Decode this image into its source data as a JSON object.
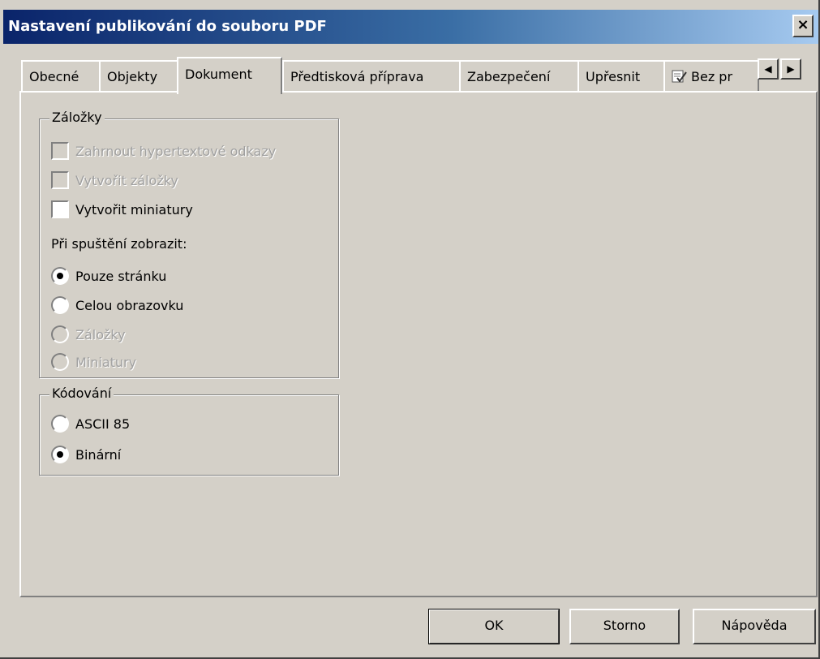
{
  "window": {
    "title": "Nastavení publikování do souboru PDF",
    "close_label": "×"
  },
  "tabs": [
    {
      "label": "Obecné",
      "active": false
    },
    {
      "label": "Objekty",
      "active": false
    },
    {
      "label": "Dokument",
      "active": true
    },
    {
      "label": "Předtisková příprava",
      "active": false
    },
    {
      "label": "Zabezpečení",
      "active": false
    },
    {
      "label": "Upřesnit",
      "active": false
    },
    {
      "label": "Bez pr",
      "active": false,
      "icon": "checklist-icon"
    }
  ],
  "tab_scroll": {
    "left": "◀",
    "right": "▶"
  },
  "bookmarks_group": {
    "legend": "Záložky",
    "checkboxes": [
      {
        "label": "Zahrnout hypertextové odkazy",
        "checked": false,
        "disabled": true
      },
      {
        "label": "Vytvořit záložky",
        "checked": false,
        "disabled": true
      },
      {
        "label": "Vytvořit miniatury",
        "checked": false,
        "disabled": false
      }
    ],
    "on_start_label": "Při spuštění zobrazit:",
    "on_start_options": [
      {
        "label": "Pouze stránku",
        "selected": true,
        "disabled": false
      },
      {
        "label": "Celou obrazovku",
        "selected": false,
        "disabled": false
      },
      {
        "label": "Záložky",
        "selected": false,
        "disabled": true
      },
      {
        "label": "Miniatury",
        "selected": false,
        "disabled": true
      }
    ]
  },
  "encoding_group": {
    "legend": "Kódování",
    "options": [
      {
        "label": "ASCII 85",
        "selected": false
      },
      {
        "label": "Binární",
        "selected": true
      }
    ]
  },
  "buttons": {
    "ok": "OK",
    "cancel": "Storno",
    "help": "Nápověda"
  }
}
